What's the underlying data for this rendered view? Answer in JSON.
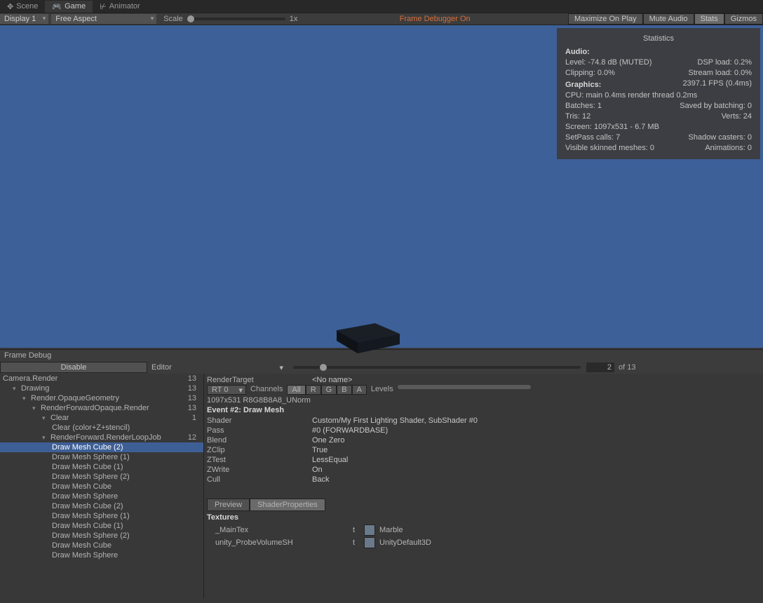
{
  "tabs": {
    "scene": "Scene",
    "game": "Game",
    "animator": "Animator"
  },
  "toolbar": {
    "display": "Display 1",
    "aspect": "Free Aspect",
    "scale_label": "Scale",
    "scale_value": "1x",
    "frame_debugger": "Frame Debugger On",
    "maximize": "Maximize On Play",
    "mute": "Mute Audio",
    "stats": "Stats",
    "gizmos": "Gizmos"
  },
  "stats": {
    "title": "Statistics",
    "audio_h": "Audio:",
    "audio_level": "Level: -74.8 dB (MUTED)",
    "dsp": "DSP load: 0.2%",
    "clipping": "Clipping: 0.0%",
    "stream": "Stream load: 0.0%",
    "gfx_h": "Graphics:",
    "fps": "2397.1 FPS (0.4ms)",
    "cpu": "CPU: main 0.4ms  render thread 0.2ms",
    "batches": "Batches: 1",
    "saved": "Saved by batching: 0",
    "tris": "Tris: 12",
    "verts": "Verts: 24",
    "screen": "Screen: 1097x531 - 6.7 MB",
    "setpass": "SetPass calls: 7",
    "shadow": "Shadow casters: 0",
    "skinned": "Visible skinned meshes: 0",
    "anim": "Animations: 0"
  },
  "fd": {
    "title": "Frame Debug",
    "disable": "Disable",
    "editor": "Editor",
    "current": "2",
    "of": "of 13"
  },
  "tree": [
    {
      "d": 0,
      "f": false,
      "n": "Camera.Render",
      "c": "13"
    },
    {
      "d": 1,
      "f": true,
      "n": "Drawing",
      "c": "13"
    },
    {
      "d": 2,
      "f": true,
      "n": "Render.OpaqueGeometry",
      "c": "13"
    },
    {
      "d": 3,
      "f": true,
      "n": "RenderForwardOpaque.Render",
      "c": "13"
    },
    {
      "d": 4,
      "f": true,
      "n": "Clear",
      "c": "1"
    },
    {
      "d": 5,
      "f": false,
      "n": "Clear (color+Z+stencil)",
      "c": ""
    },
    {
      "d": 4,
      "f": true,
      "n": "RenderForward.RenderLoopJob",
      "c": "12"
    },
    {
      "d": 5,
      "f": false,
      "n": "Draw Mesh Cube (2)",
      "c": "",
      "sel": true
    },
    {
      "d": 5,
      "f": false,
      "n": "Draw Mesh Sphere (1)",
      "c": ""
    },
    {
      "d": 5,
      "f": false,
      "n": "Draw Mesh Cube (1)",
      "c": ""
    },
    {
      "d": 5,
      "f": false,
      "n": "Draw Mesh Sphere (2)",
      "c": ""
    },
    {
      "d": 5,
      "f": false,
      "n": "Draw Mesh Cube",
      "c": ""
    },
    {
      "d": 5,
      "f": false,
      "n": "Draw Mesh Sphere",
      "c": ""
    },
    {
      "d": 5,
      "f": false,
      "n": "Draw Mesh Cube (2)",
      "c": ""
    },
    {
      "d": 5,
      "f": false,
      "n": "Draw Mesh Sphere (1)",
      "c": ""
    },
    {
      "d": 5,
      "f": false,
      "n": "Draw Mesh Cube (1)",
      "c": ""
    },
    {
      "d": 5,
      "f": false,
      "n": "Draw Mesh Sphere (2)",
      "c": ""
    },
    {
      "d": 5,
      "f": false,
      "n": "Draw Mesh Cube",
      "c": ""
    },
    {
      "d": 5,
      "f": false,
      "n": "Draw Mesh Sphere",
      "c": ""
    }
  ],
  "details": {
    "rt_label": "RenderTarget",
    "rt_name": "<No name>",
    "rt0": "RT 0",
    "channels": "Channels",
    "all": "All",
    "r": "R",
    "g": "G",
    "b": "B",
    "a": "A",
    "levels": "Levels",
    "fmt": "1097x531 R8G8B8A8_UNorm",
    "event": "Event #2: Draw Mesh",
    "rows": [
      {
        "k": "Shader",
        "v": "Custom/My First Lighting Shader, SubShader #0"
      },
      {
        "k": "Pass",
        "v": "#0 (FORWARDBASE)"
      },
      {
        "k": "Blend",
        "v": "One Zero"
      },
      {
        "k": "ZClip",
        "v": "True"
      },
      {
        "k": "ZTest",
        "v": "LessEqual"
      },
      {
        "k": "ZWrite",
        "v": "On"
      },
      {
        "k": "Cull",
        "v": "Back"
      }
    ],
    "preview": "Preview",
    "shaderprops": "ShaderProperties",
    "textures": "Textures",
    "tex": [
      {
        "n": "_MainTex",
        "t": "t",
        "v": "Marble"
      },
      {
        "n": "unity_ProbeVolumeSH",
        "t": "t",
        "v": "UnityDefault3D"
      }
    ]
  }
}
